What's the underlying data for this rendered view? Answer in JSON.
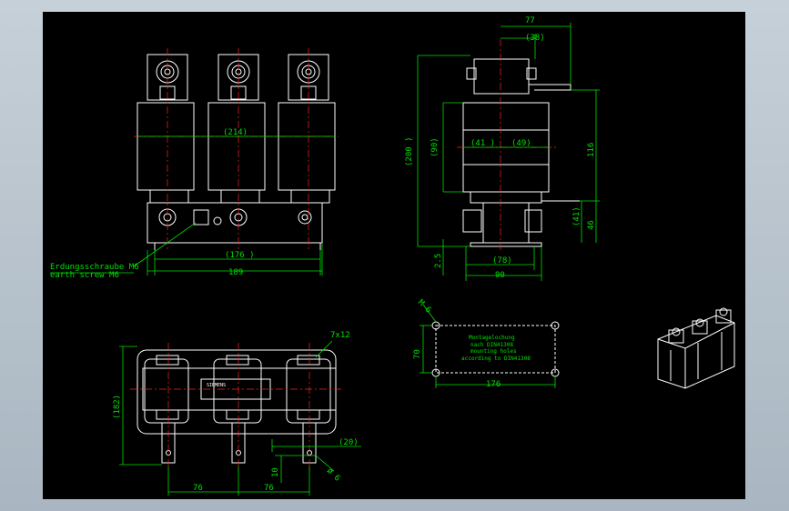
{
  "colors": {
    "background": "#000000",
    "geometry": "#ffffff",
    "dimension": "#00e000",
    "centerline": "#ff2020",
    "window_frame": "#b8c4ce"
  },
  "front_view": {
    "dim_width_inner": "(214)",
    "dim_176": "(176 )",
    "dim_189": "189",
    "note_de": "Erdungsschraube M6",
    "note_en": "earth screw M6"
  },
  "side_view": {
    "dim_77": "77",
    "dim_38": "(38)",
    "dim_200": "(200 )",
    "dim_90v": "(90)",
    "dim_41": "(41 )",
    "dim_49": "(49)",
    "dim_116": "116",
    "dim_41b": "(41)",
    "dim_46": "46",
    "dim_25": "2.5",
    "dim_78": "(78)",
    "dim_90": "90"
  },
  "mounting": {
    "hole": "M 6",
    "note_line1": "Montagelochung",
    "note_line2": "nach DIN41308",
    "note_line3": "mounting holes",
    "note_line4": "according to DIN41308",
    "dim_70": "70",
    "dim_176": "176"
  },
  "top_view": {
    "slot": "7x12",
    "dim_182": "(182)",
    "dim_20": "(20)",
    "dim_10": "10",
    "dim_06": "ø 6",
    "dim_76a": "76",
    "dim_76b": "76",
    "label": "SIEMENS"
  }
}
